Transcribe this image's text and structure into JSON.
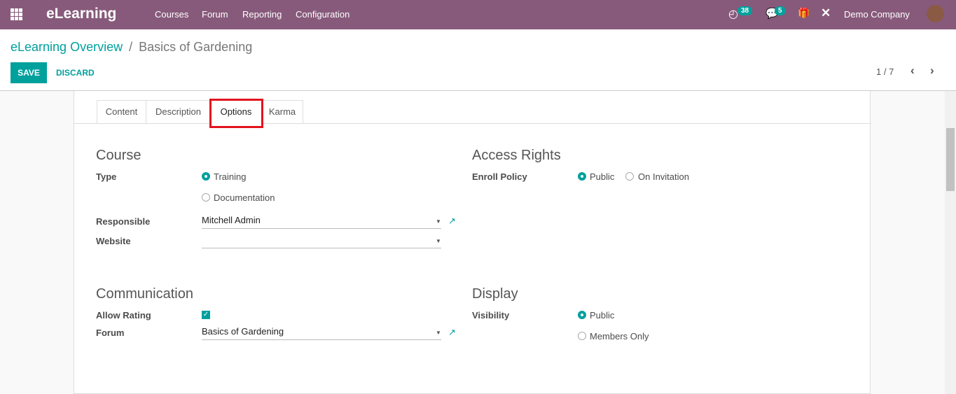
{
  "nav": {
    "brand": "eLearning",
    "menu": [
      "Courses",
      "Forum",
      "Reporting",
      "Configuration"
    ],
    "activity_count": "38",
    "message_count": "5",
    "company": "Demo Company"
  },
  "breadcrumb": {
    "parent": "eLearning Overview",
    "sep": "/",
    "current": "Basics of Gardening"
  },
  "buttons": {
    "save": "SAVE",
    "discard": "DISCARD"
  },
  "pager": {
    "text": "1 / 7"
  },
  "tabs": [
    "Content",
    "Description",
    "Options",
    "Karma"
  ],
  "active_tab": "Options",
  "course": {
    "title": "Course",
    "type_label": "Type",
    "type_options": [
      "Training",
      "Documentation"
    ],
    "type_selected": "Training",
    "responsible_label": "Responsible",
    "responsible": "Mitchell Admin",
    "website_label": "Website",
    "website": ""
  },
  "access": {
    "title": "Access Rights",
    "enroll_label": "Enroll Policy",
    "options": [
      "Public",
      "On Invitation"
    ],
    "selected": "Public"
  },
  "communication": {
    "title": "Communication",
    "rating_label": "Allow Rating",
    "rating": true,
    "forum_label": "Forum",
    "forum": "Basics of Gardening"
  },
  "display": {
    "title": "Display",
    "visibility_label": "Visibility",
    "options": [
      "Public",
      "Members Only"
    ],
    "selected": "Public"
  },
  "colors": {
    "navbar": "#875a7b",
    "accent": "#00a09d",
    "highlight": "#e3141e"
  }
}
